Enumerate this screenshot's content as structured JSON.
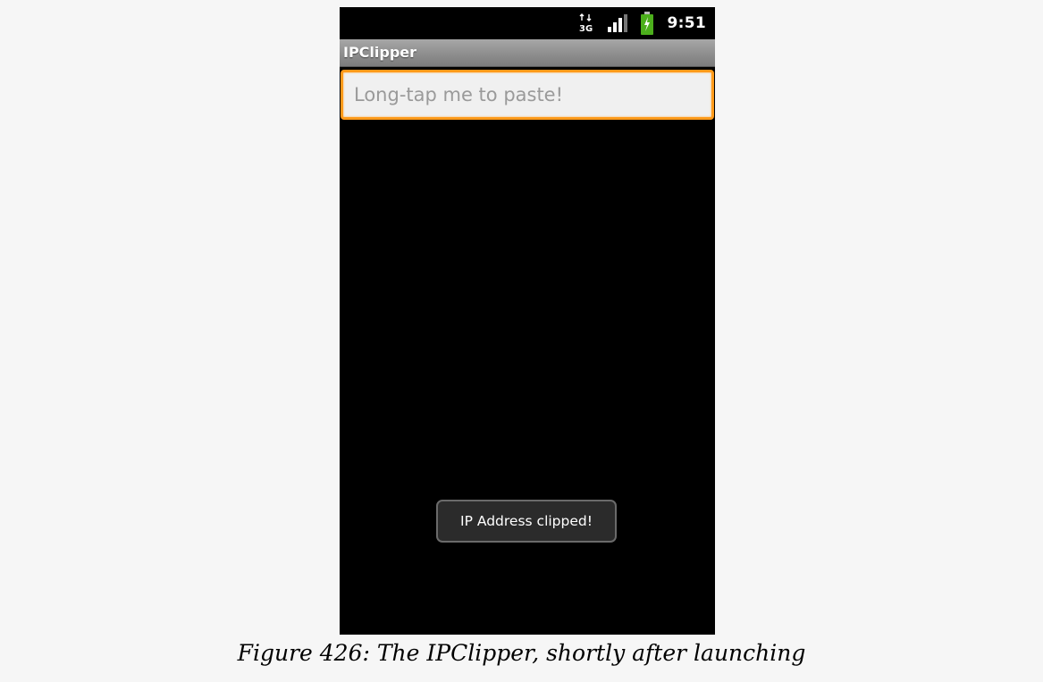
{
  "status_bar": {
    "network_icon": "3g-data-icon",
    "network_label": "3G",
    "signal_icon": "signal-strength-icon",
    "battery_icon": "battery-charging-icon",
    "time": "9:51"
  },
  "app": {
    "title": "IPClipper",
    "input_placeholder": "Long-tap me to paste!",
    "input_value": ""
  },
  "toast": {
    "message": "IP Address clipped!"
  },
  "caption": "Figure 426: The IPClipper, shortly after launching",
  "colors": {
    "focus_border": "#ff9a1a",
    "title_bar": "#8c8c8c",
    "battery": "#4caf1c"
  }
}
